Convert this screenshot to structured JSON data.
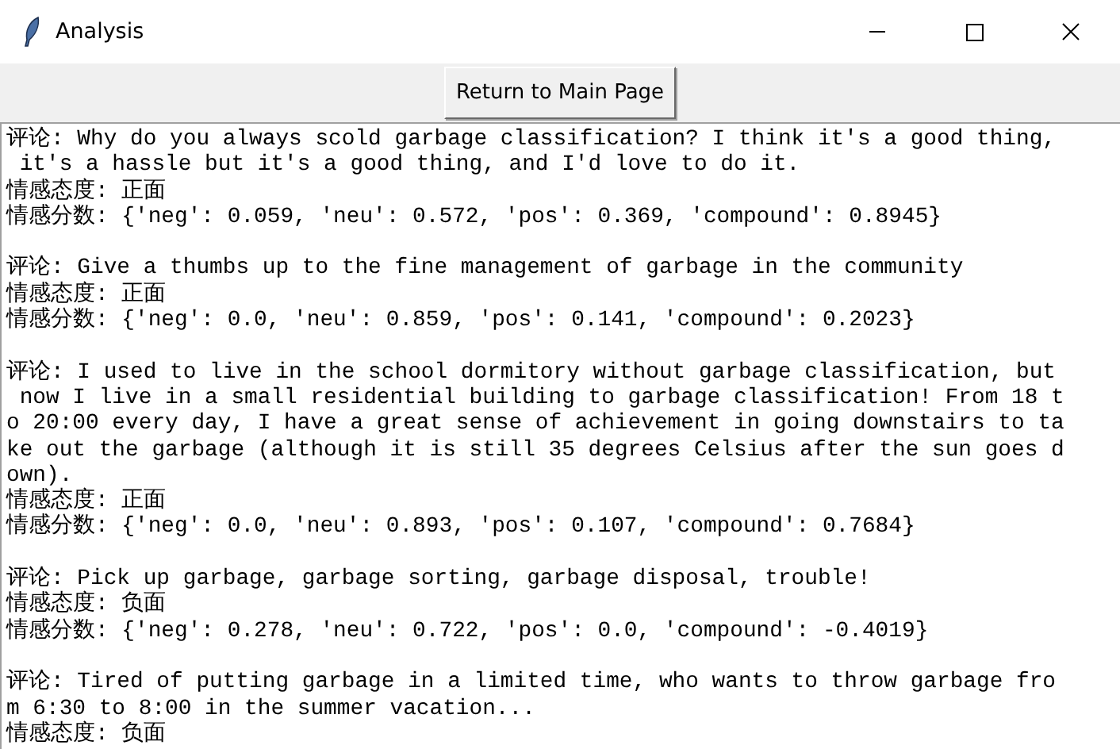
{
  "window": {
    "title": "Analysis"
  },
  "toolbar": {
    "button": "Return to Main Page"
  },
  "entries": [
    {
      "comment_lines": [
        "评论: Why do you always scold garbage classification? I think it's a good thing,",
        " it's a hassle but it's a good thing, and I'd love to do it."
      ],
      "attitude": "情感态度: 正面",
      "scores": "情感分数: {'neg': 0.059, 'neu': 0.572, 'pos': 0.369, 'compound': 0.8945}"
    },
    {
      "comment_lines": [
        "评论: Give a thumbs up to the fine management of garbage in the community"
      ],
      "attitude": "情感态度: 正面",
      "scores": "情感分数: {'neg': 0.0, 'neu': 0.859, 'pos': 0.141, 'compound': 0.2023}"
    },
    {
      "comment_lines": [
        "评论: I used to live in the school dormitory without garbage classification, but",
        " now I live in a small residential building to garbage classification! From 18 t",
        "o 20:00 every day, I have a great sense of achievement in going downstairs to ta",
        "ke out the garbage (although it is still 35 degrees Celsius after the sun goes d",
        "own)."
      ],
      "attitude": "情感态度: 正面",
      "scores": "情感分数: {'neg': 0.0, 'neu': 0.893, 'pos': 0.107, 'compound': 0.7684}"
    },
    {
      "comment_lines": [
        "评论: Pick up garbage, garbage sorting, garbage disposal, trouble!"
      ],
      "attitude": "情感态度: 负面",
      "scores": "情感分数: {'neg': 0.278, 'neu': 0.722, 'pos': 0.0, 'compound': -0.4019}"
    },
    {
      "comment_lines": [
        "评论: Tired of putting garbage in a limited time, who wants to throw garbage fro",
        "m 6:30 to 8:00 in the summer vacation..."
      ],
      "attitude": "情感态度: 负面"
    }
  ]
}
